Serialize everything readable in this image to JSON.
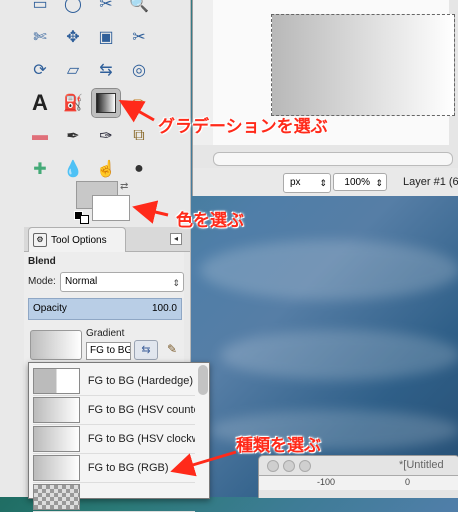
{
  "annotations": {
    "gradient_tool": "グラデーションを選ぶ",
    "color": "色を選ぶ",
    "type": "種類を選ぶ"
  },
  "toolbox": {
    "tools": [
      {
        "icon": "rect-select-icon"
      },
      {
        "icon": "ellipse-select-icon"
      },
      {
        "icon": "free-select-icon"
      },
      {
        "icon": "zoom-icon"
      },
      {
        "icon": "scissors-select-icon"
      },
      {
        "icon": "move-icon"
      },
      {
        "icon": "align-icon"
      },
      {
        "icon": "crop-icon"
      },
      {
        "icon": "rotate-icon"
      },
      {
        "icon": "perspective-icon"
      },
      {
        "icon": "flip-icon"
      },
      {
        "icon": "cage-icon"
      },
      {
        "icon": "text-icon"
      },
      {
        "icon": "bucket-fill-icon"
      },
      {
        "icon": "blend-icon"
      },
      {
        "icon": "pencil-icon"
      },
      {
        "icon": "eraser-icon"
      },
      {
        "icon": "airbrush-icon"
      },
      {
        "icon": "ink-icon"
      },
      {
        "icon": "clone-icon"
      },
      {
        "icon": "heal-icon"
      },
      {
        "icon": "blur-icon"
      },
      {
        "icon": "smudge-icon"
      },
      {
        "icon": "dodge-icon"
      }
    ],
    "fg_color": "#c8c8c8",
    "bg_color": "#ffffff"
  },
  "tool_options": {
    "tab_label": "Tool Options",
    "tool_name": "Blend",
    "mode_label": "Mode:",
    "mode_value": "Normal",
    "opacity_label": "Opacity",
    "opacity_value": "100.0",
    "gradient_label": "Gradient",
    "gradient_name": "FG to BG (RGB)"
  },
  "gradient_list": [
    {
      "label": "FG to BG (Hardedge)",
      "style": "hard"
    },
    {
      "label": "FG to BG (HSV counter-clockwise)",
      "style": "smooth"
    },
    {
      "label": "FG to BG (HSV clockwise hue)",
      "style": "smooth"
    },
    {
      "label": "FG to BG (RGB)",
      "style": "smooth"
    },
    {
      "label": "",
      "style": "checker"
    }
  ],
  "image_window": {
    "unit": "px",
    "zoom": "100%",
    "layer": "Layer #1 (6",
    "second_title": "*[Untitled",
    "ruler_marks": [
      "-100",
      "0"
    ]
  }
}
